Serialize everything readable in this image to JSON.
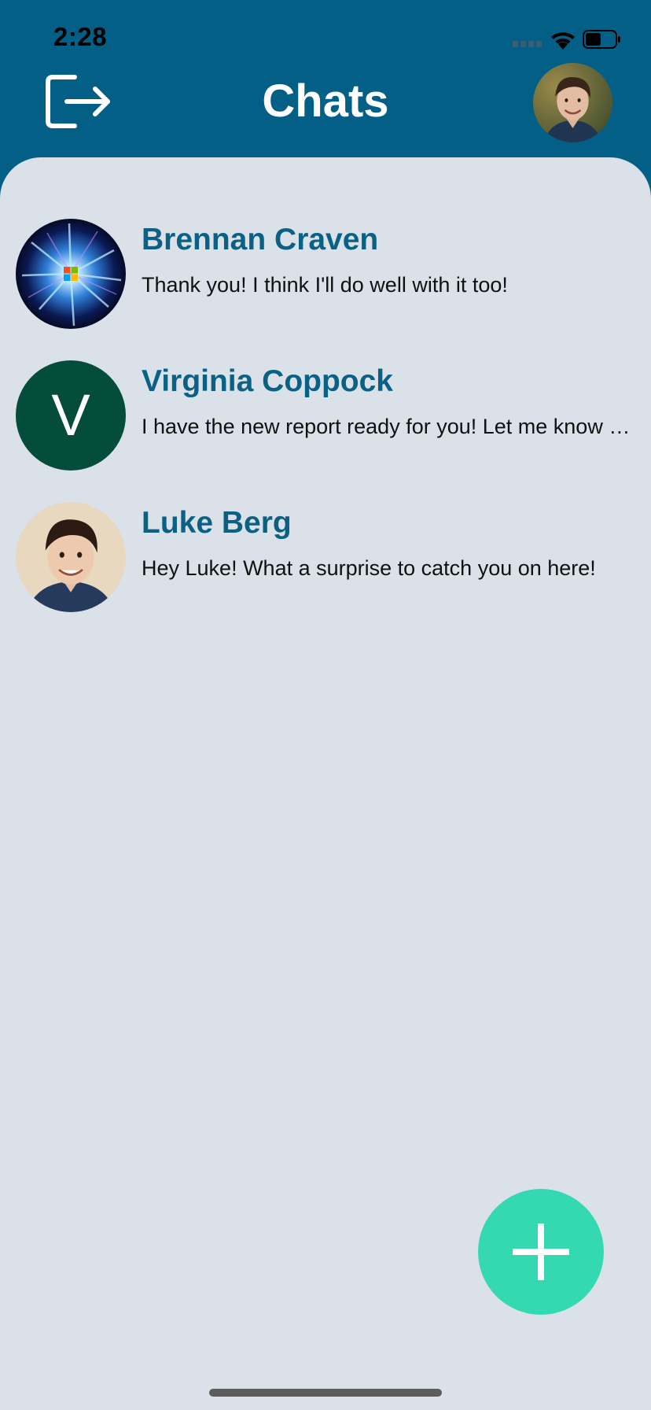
{
  "status_bar": {
    "time": "2:28",
    "icons": [
      "cellular-signal-icon",
      "wifi-icon",
      "battery-icon"
    ]
  },
  "header": {
    "title": "Chats",
    "logout_icon": "logout-icon",
    "profile_avatar": "user-photo"
  },
  "chats": [
    {
      "name": "Brennan Craven",
      "preview": "Thank you! I think I'll do well with it too!",
      "avatar_type": "image",
      "avatar_desc": "windows-logo-burst"
    },
    {
      "name": "Virginia Coppock",
      "preview": "I have the new report ready for you! Let me know what you think.",
      "avatar_type": "letter",
      "avatar_letter": "V",
      "avatar_color": "#034d3a"
    },
    {
      "name": "Luke Berg",
      "preview": "Hey Luke! What a surprise to catch you on here!",
      "avatar_type": "image",
      "avatar_desc": "user-photo"
    }
  ],
  "fab": {
    "icon": "plus-icon"
  },
  "colors": {
    "header_bg": "#035f86",
    "sheet_bg": "#dae1e8",
    "name_text": "#0b6184",
    "fab_bg": "#35d9b1"
  }
}
